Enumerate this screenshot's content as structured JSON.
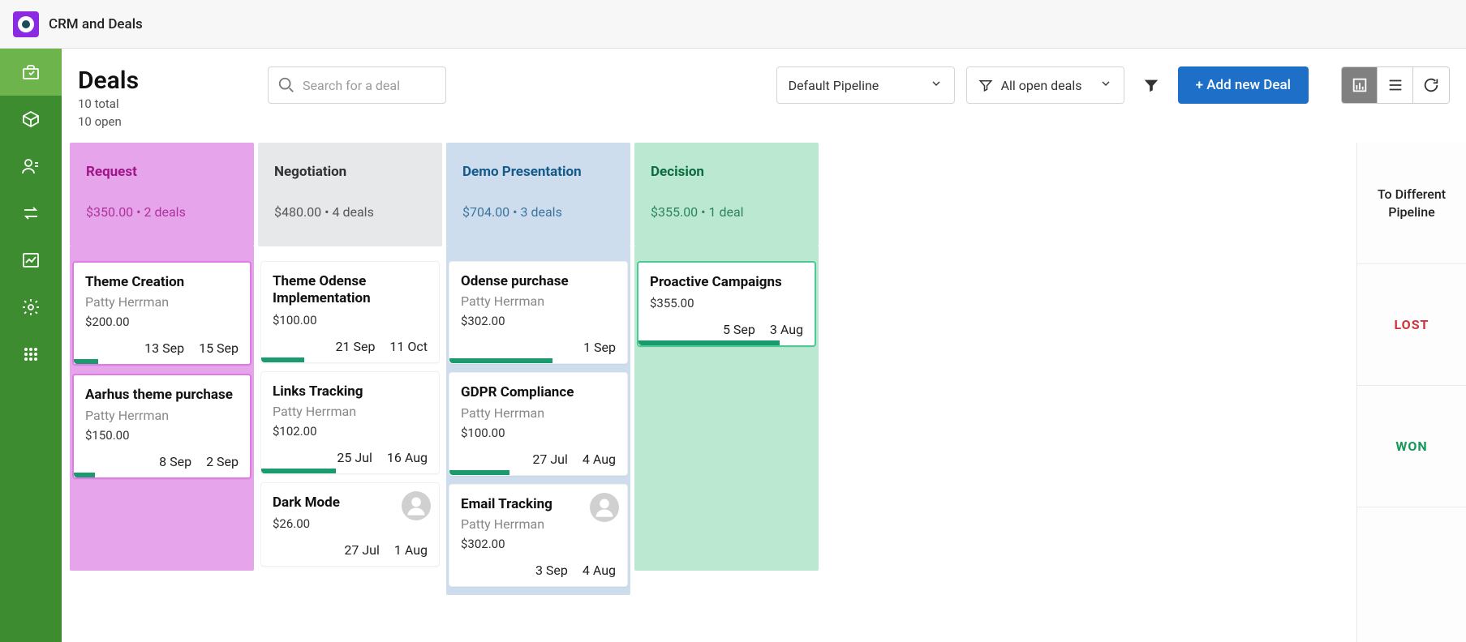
{
  "app": {
    "title": "CRM and Deals"
  },
  "page": {
    "title": "Deals",
    "total_line": "10 total",
    "open_line": "10 open"
  },
  "search": {
    "placeholder": "Search for a deal"
  },
  "pipeline_select": {
    "label": "Default Pipeline"
  },
  "deal_filter": {
    "label": "All open deals"
  },
  "add_button": {
    "label": "+ Add new Deal"
  },
  "rightrail": {
    "to_pipeline": "To Different Pipeline",
    "lost": "LOST",
    "won": "WON"
  },
  "stages": [
    {
      "name": "Request",
      "summary": "$350.00 • 2 deals",
      "cards": [
        {
          "title": "Theme Creation",
          "owner": "Patty Herrman",
          "amount": "$200.00",
          "date1": "13 Sep",
          "date2": "15 Sep",
          "progress": 14
        },
        {
          "title": "Aarhus theme purchase",
          "owner": "Patty Herrman",
          "amount": "$150.00",
          "date1": "8 Sep",
          "date2": "2 Sep",
          "progress": 12
        }
      ]
    },
    {
      "name": "Negotiation",
      "summary": "$480.00 • 4 deals",
      "cards": [
        {
          "title": "Theme Odense Implementation",
          "owner": "",
          "amount": "$100.00",
          "date1": "21 Sep",
          "date2": "11 Oct",
          "progress": 24
        },
        {
          "title": "Links Tracking",
          "owner": "Patty Herrman",
          "amount": "$102.00",
          "date1": "25 Jul",
          "date2": "16 Aug",
          "progress": 42
        },
        {
          "title": "Dark Mode",
          "owner": "",
          "amount": "$26.00",
          "date1": "27 Jul",
          "date2": "1 Aug",
          "progress": 0,
          "avatar": true
        }
      ]
    },
    {
      "name": "Demo Presentation",
      "summary": "$704.00 • 3 deals",
      "cards": [
        {
          "title": "Odense purchase",
          "owner": "Patty Herrman",
          "amount": "$302.00",
          "date1": "",
          "date2": "1 Sep",
          "progress": 58
        },
        {
          "title": "GDPR Compliance",
          "owner": "Patty Herrman",
          "amount": "$100.00",
          "date1": "27 Jul",
          "date2": "4 Aug",
          "progress": 34
        },
        {
          "title": "Email Tracking",
          "owner": "Patty Herrman",
          "amount": "$302.00",
          "date1": "3 Sep",
          "date2": "4 Aug",
          "progress": 0,
          "avatar": true
        }
      ]
    },
    {
      "name": "Decision",
      "summary": "$355.00 • 1 deal",
      "cards": [
        {
          "title": "Proactive Campaigns",
          "owner": "",
          "amount": "$355.00",
          "date1": "5 Sep",
          "date2": "3 Aug",
          "progress": 80
        }
      ]
    }
  ]
}
